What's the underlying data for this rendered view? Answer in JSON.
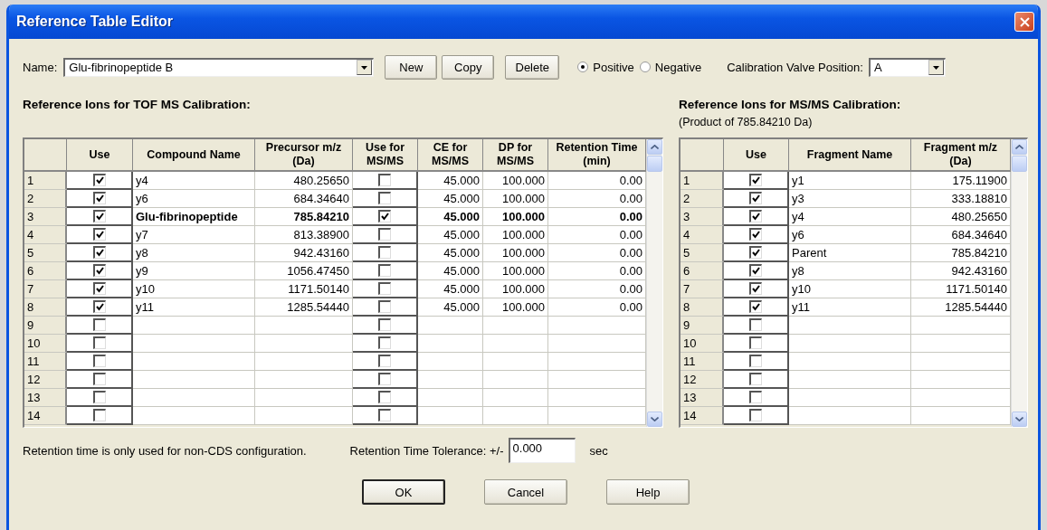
{
  "window": {
    "title": "Reference Table Editor"
  },
  "name_field": {
    "label": "Name:",
    "value": "Glu-fibrinopeptide B"
  },
  "buttons": [
    "New",
    "Copy",
    "Delete"
  ],
  "polarity": [
    {
      "label": "Positive",
      "selected": true
    },
    {
      "label": "Negative",
      "selected": false
    }
  ],
  "valve": {
    "label": "Calibration Valve Position:",
    "value": "A"
  },
  "tof_table": {
    "title": "Reference Ions for TOF MS Calibration:",
    "columns": [
      {
        "label": "Use",
        "kind": "check"
      },
      {
        "label": "Compound Name",
        "kind": "text"
      },
      {
        "label": "Precursor m/z (Da)",
        "kind": "numeric"
      },
      {
        "label": "Use for MS/MS",
        "kind": "check"
      },
      {
        "label": "CE for MS/MS",
        "kind": "numeric"
      },
      {
        "label": "DP for MS/MS",
        "kind": "numeric"
      },
      {
        "label": "Retention Time (min)",
        "kind": "numeric"
      }
    ],
    "rows": [
      {
        "number": "1",
        "use": true,
        "compound_name": "y4",
        "precursor_mz": "480.25650",
        "use_for_msms": false,
        "ce": "45.000",
        "dp": "100.000",
        "retention_time": "0.00",
        "bold": false
      },
      {
        "number": "2",
        "use": true,
        "compound_name": "y6",
        "precursor_mz": "684.34640",
        "use_for_msms": false,
        "ce": "45.000",
        "dp": "100.000",
        "retention_time": "0.00",
        "bold": false
      },
      {
        "number": "3",
        "use": true,
        "compound_name": "Glu-fibrinopeptide",
        "precursor_mz": "785.84210",
        "use_for_msms": true,
        "ce": "45.000",
        "dp": "100.000",
        "retention_time": "0.00",
        "bold": true
      },
      {
        "number": "4",
        "use": true,
        "compound_name": "y7",
        "precursor_mz": "813.38900",
        "use_for_msms": false,
        "ce": "45.000",
        "dp": "100.000",
        "retention_time": "0.00",
        "bold": false
      },
      {
        "number": "5",
        "use": true,
        "compound_name": "y8",
        "precursor_mz": "942.43160",
        "use_for_msms": false,
        "ce": "45.000",
        "dp": "100.000",
        "retention_time": "0.00",
        "bold": false
      },
      {
        "number": "6",
        "use": true,
        "compound_name": "y9",
        "precursor_mz": "1056.47450",
        "use_for_msms": false,
        "ce": "45.000",
        "dp": "100.000",
        "retention_time": "0.00",
        "bold": false
      },
      {
        "number": "7",
        "use": true,
        "compound_name": "y10",
        "precursor_mz": "1171.50140",
        "use_for_msms": false,
        "ce": "45.000",
        "dp": "100.000",
        "retention_time": "0.00",
        "bold": false
      },
      {
        "number": "8",
        "use": true,
        "compound_name": "y11",
        "precursor_mz": "1285.54440",
        "use_for_msms": false,
        "ce": "45.000",
        "dp": "100.000",
        "retention_time": "0.00",
        "bold": false
      },
      {
        "number": "9",
        "use": false,
        "use_for_msms": false
      },
      {
        "number": "10",
        "use": false,
        "use_for_msms": false
      },
      {
        "number": "11",
        "use": false,
        "use_for_msms": false
      },
      {
        "number": "12",
        "use": false,
        "use_for_msms": false
      },
      {
        "number": "13",
        "use": false,
        "use_for_msms": false
      },
      {
        "number": "14",
        "use": false,
        "use_for_msms": false
      }
    ]
  },
  "msms_table": {
    "title": "Reference Ions for MS/MS Calibration:",
    "subtitle": "(Product of 785.84210 Da)",
    "columns": [
      {
        "label": "Use",
        "kind": "check"
      },
      {
        "label": "Fragment Name",
        "kind": "text"
      },
      {
        "label": "Fragment m/z (Da)",
        "kind": "numeric"
      }
    ],
    "rows": [
      {
        "number": "1",
        "use": true,
        "fragment_name": "y1",
        "fragment_mz": "175.11900"
      },
      {
        "number": "2",
        "use": true,
        "fragment_name": "y3",
        "fragment_mz": "333.18810"
      },
      {
        "number": "3",
        "use": true,
        "fragment_name": "y4",
        "fragment_mz": "480.25650"
      },
      {
        "number": "4",
        "use": true,
        "fragment_name": "y6",
        "fragment_mz": "684.34640"
      },
      {
        "number": "5",
        "use": true,
        "fragment_name": "Parent",
        "fragment_mz": "785.84210"
      },
      {
        "number": "6",
        "use": true,
        "fragment_name": "y8",
        "fragment_mz": "942.43160"
      },
      {
        "number": "7",
        "use": true,
        "fragment_name": "y10",
        "fragment_mz": "1171.50140"
      },
      {
        "number": "8",
        "use": true,
        "fragment_name": "y11",
        "fragment_mz": "1285.54440"
      },
      {
        "number": "9",
        "use": false
      },
      {
        "number": "10",
        "use": false
      },
      {
        "number": "11",
        "use": false
      },
      {
        "number": "12",
        "use": false
      },
      {
        "number": "13",
        "use": false
      },
      {
        "number": "14",
        "use": false
      }
    ]
  },
  "note": "Retention time is only used for non-CDS configuration.",
  "tolerance": {
    "label": "Retention Time Tolerance: +/-",
    "value": "0.000",
    "unit": "sec"
  },
  "dialog_buttons": [
    {
      "label": "OK",
      "default": true
    },
    {
      "label": "Cancel",
      "default": false
    },
    {
      "label": "Help",
      "default": false
    }
  ]
}
